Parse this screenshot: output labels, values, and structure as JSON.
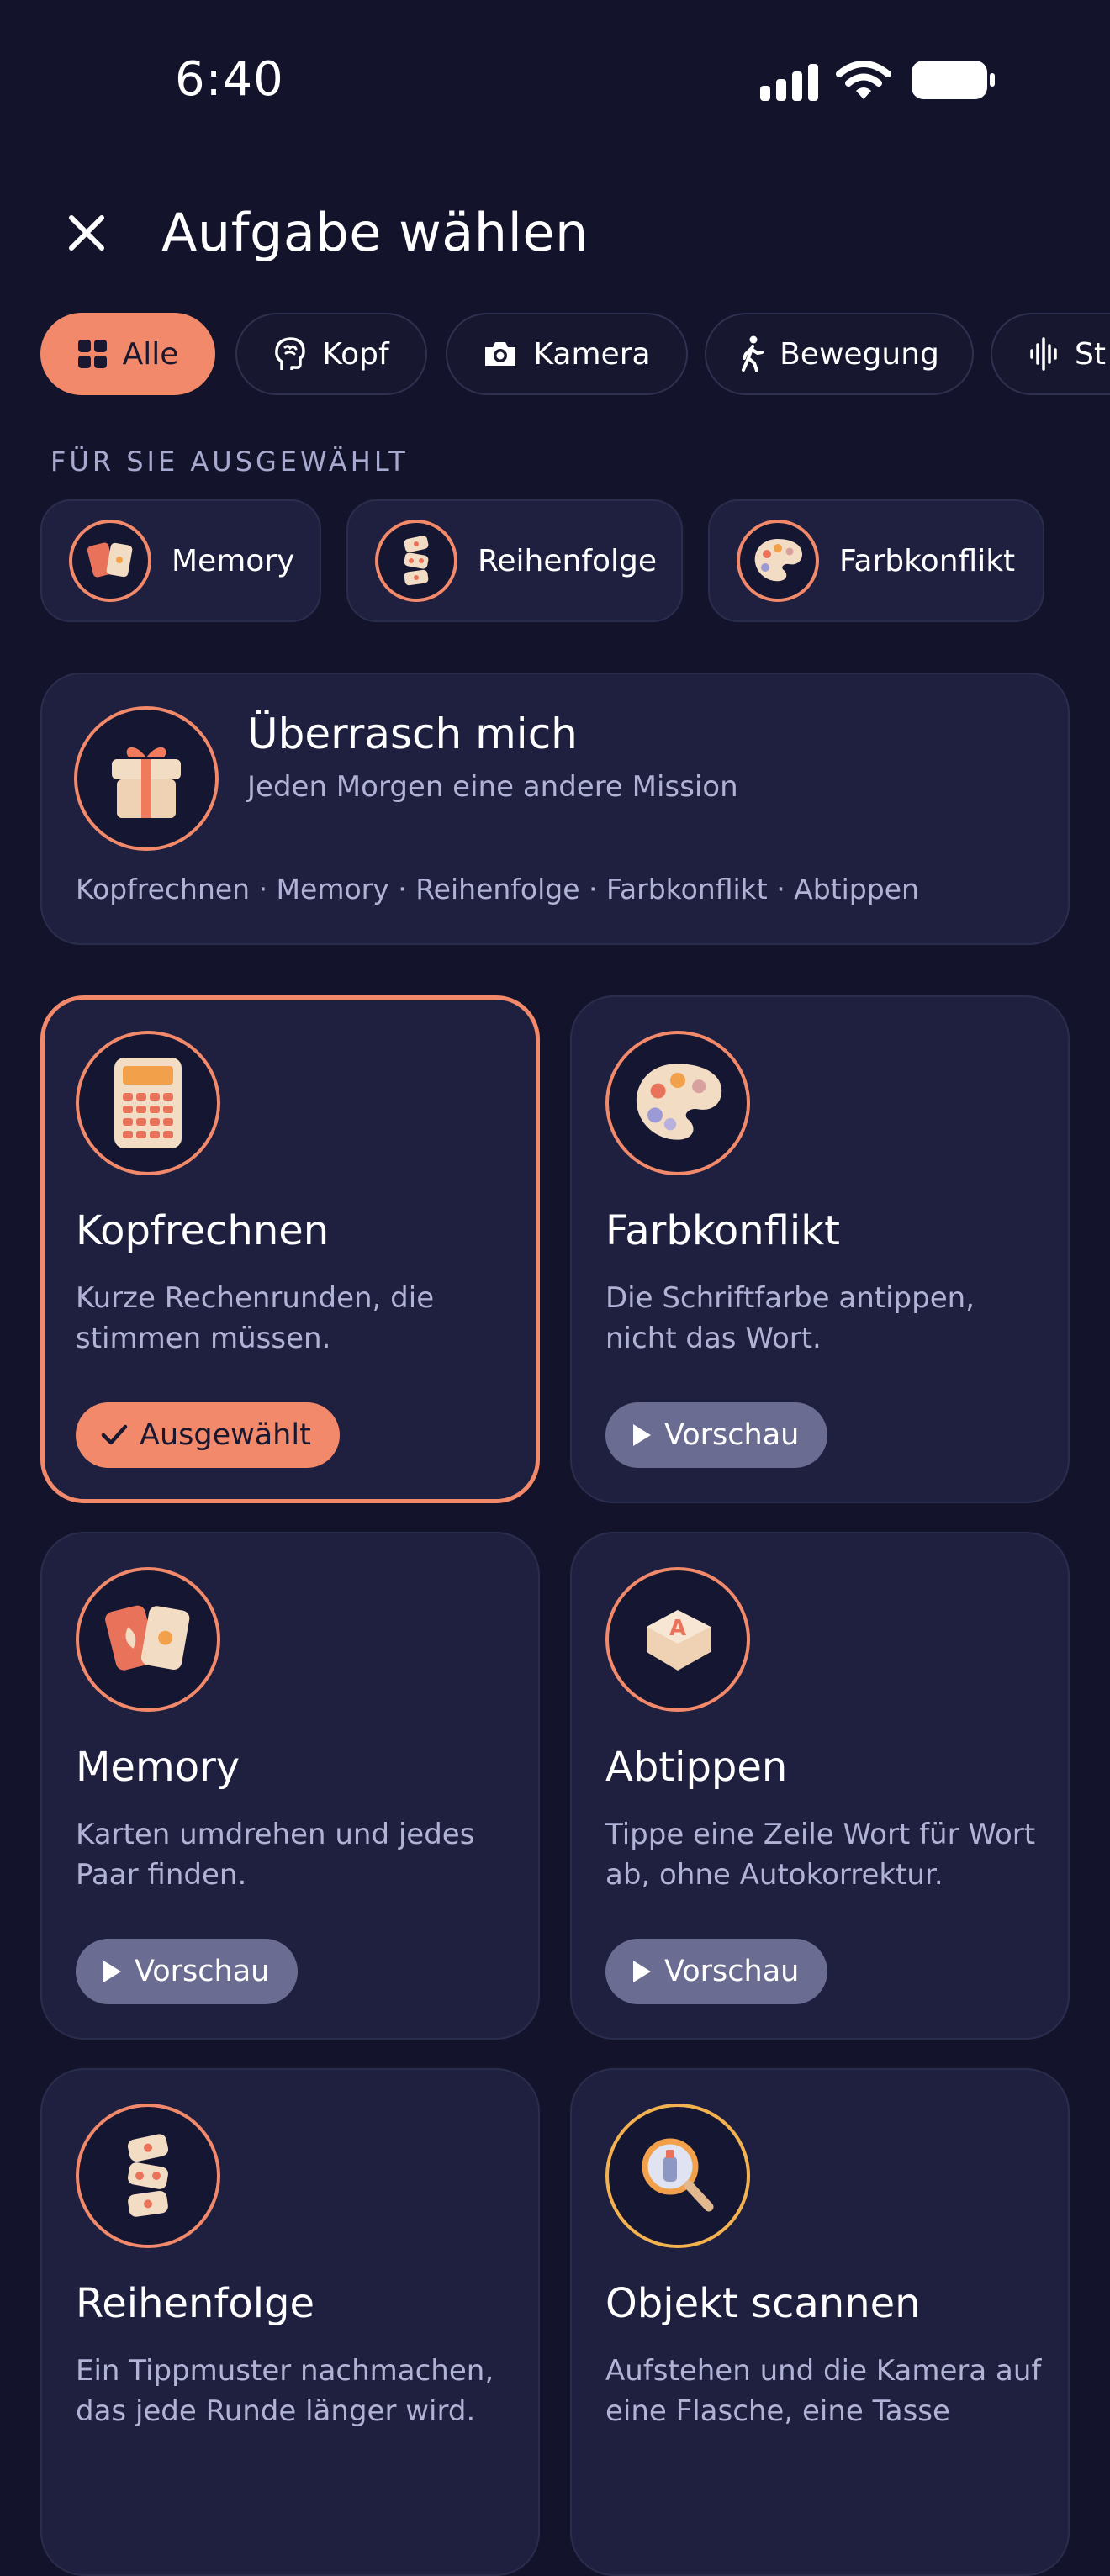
{
  "status": {
    "time": "6:40"
  },
  "header": {
    "title": "Aufgabe wählen",
    "close_icon": "close-icon"
  },
  "filters": [
    {
      "label": "Alle",
      "icon": "grid-icon",
      "active": true
    },
    {
      "label": "Kopf",
      "icon": "brain-icon"
    },
    {
      "label": "Kamera",
      "icon": "camera-icon"
    },
    {
      "label": "Bewegung",
      "icon": "walking-icon"
    },
    {
      "label": "St",
      "icon": "audio-wave-icon"
    }
  ],
  "section_label": "FÜR SIE AUSGEWÄHLT",
  "quick_picks": [
    {
      "label": "Memory",
      "icon": "cards-icon"
    },
    {
      "label": "Reihenfolge",
      "icon": "dice-stack-icon"
    },
    {
      "label": "Farbkonflikt",
      "icon": "palette-icon"
    }
  ],
  "surprise": {
    "title": "Überrasch mich",
    "subtitle": "Jeden Morgen eine andere Mission",
    "list": "Kopfrechnen · Memory · Reihenfolge · Farbkonflikt · Abtippen",
    "icon": "gift-icon"
  },
  "missions": [
    {
      "title": "Kopfrechnen",
      "desc": "Kurze Rechenrunden, die stimmen müssen.",
      "button": "Ausgewählt",
      "selected": true,
      "icon": "calculator-icon"
    },
    {
      "title": "Farbkonflikt",
      "desc": "Die Schriftfarbe antippen, nicht das Wort.",
      "button": "Vorschau",
      "icon": "palette-icon"
    },
    {
      "title": "Memory",
      "desc": "Karten umdrehen und jedes Paar finden.",
      "button": "Vorschau",
      "icon": "cards-icon"
    },
    {
      "title": "Abtippen",
      "desc": "Tippe eine Zeile Wort für Wort ab, ohne Autokorrektur.",
      "button": "Vorschau",
      "icon": "keycap-icon"
    },
    {
      "title": "Reihenfolge",
      "desc": "Ein Tippmuster nachmachen, das jede Runde länger wird.",
      "icon": "dice-stack-icon"
    },
    {
      "title": "Objekt scannen",
      "desc": "Aufstehen und die Kamera auf eine Flasche, eine Tasse",
      "icon": "magnifier-icon"
    }
  ],
  "colors": {
    "background": "#13142b",
    "card": "#1f2040",
    "accent": "#f2896a",
    "preview_button": "#6b6c91",
    "scan_ring": "#f3b24f"
  }
}
